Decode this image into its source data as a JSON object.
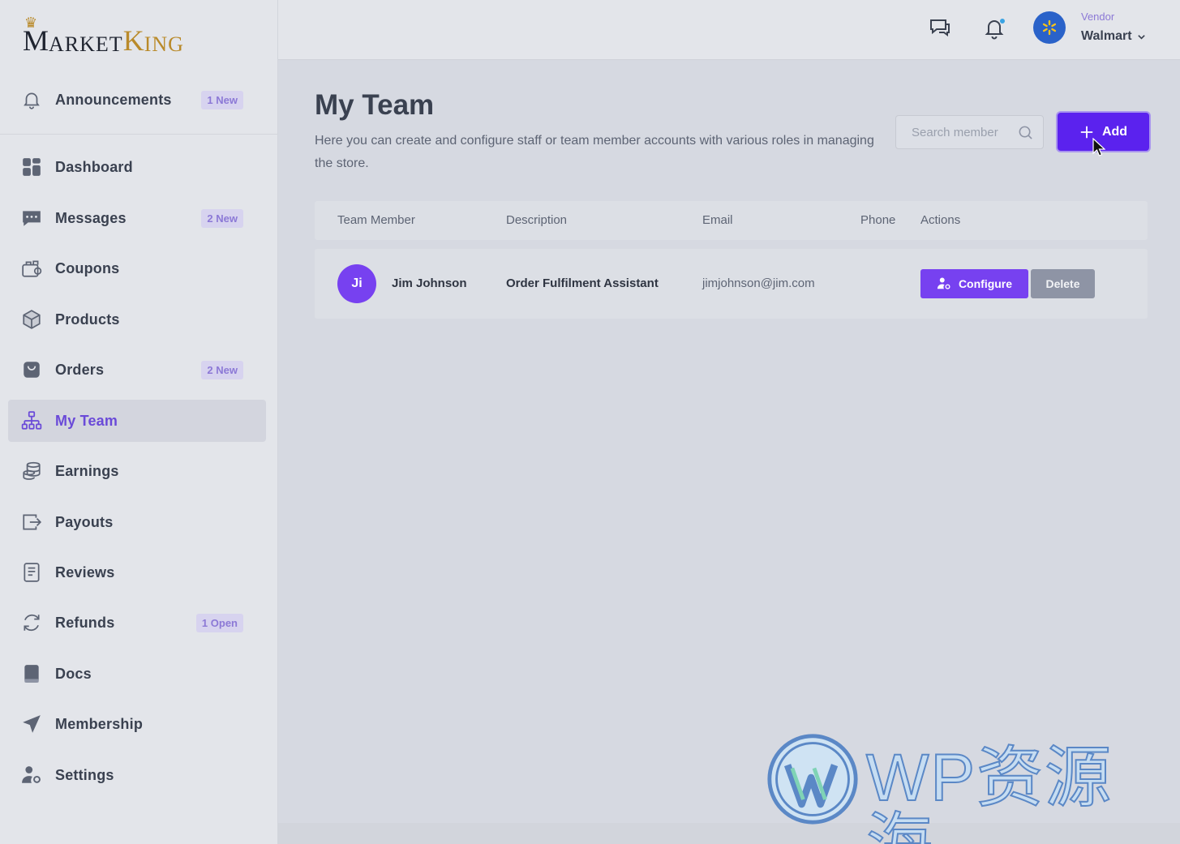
{
  "brand": {
    "name_big_1": "M",
    "name_small_1": "ARKET",
    "name_big_2": "K",
    "name_small_2": "ING"
  },
  "sidebar": {
    "announcement": {
      "label": "Announcements",
      "badge": "1 New"
    },
    "items": [
      {
        "label": "Dashboard",
        "badge": ""
      },
      {
        "label": "Messages",
        "badge": "2 New"
      },
      {
        "label": "Coupons",
        "badge": ""
      },
      {
        "label": "Products",
        "badge": ""
      },
      {
        "label": "Orders",
        "badge": "2 New"
      },
      {
        "label": "My Team",
        "badge": "",
        "active": true
      },
      {
        "label": "Earnings",
        "badge": ""
      },
      {
        "label": "Payouts",
        "badge": ""
      },
      {
        "label": "Reviews",
        "badge": ""
      },
      {
        "label": "Refunds",
        "badge": "1 Open"
      },
      {
        "label": "Docs",
        "badge": ""
      },
      {
        "label": "Membership",
        "badge": ""
      },
      {
        "label": "Settings",
        "badge": ""
      }
    ]
  },
  "topbar": {
    "vendor_label": "Vendor",
    "vendor_name": "Walmart"
  },
  "main": {
    "title": "My Team",
    "description": "Here you can create and configure staff or team member accounts with various roles in managing the store.",
    "search_placeholder": "Search member",
    "add_label": "Add"
  },
  "table": {
    "headers": [
      "Team Member",
      "Description",
      "Email",
      "Phone",
      "Actions"
    ],
    "rows": [
      {
        "initials": "Ji",
        "name": "Jim Johnson",
        "description": "Order Fulfilment Assistant",
        "email": "jimjohnson@jim.com",
        "phone": "",
        "configure_label": "Configure",
        "delete_label": "Delete"
      }
    ]
  },
  "watermark": {
    "text": "WP资源海"
  },
  "colors": {
    "accent": "#5b22ee",
    "accent_light": "#7741f0",
    "active_nav": "#6a4ad8"
  }
}
